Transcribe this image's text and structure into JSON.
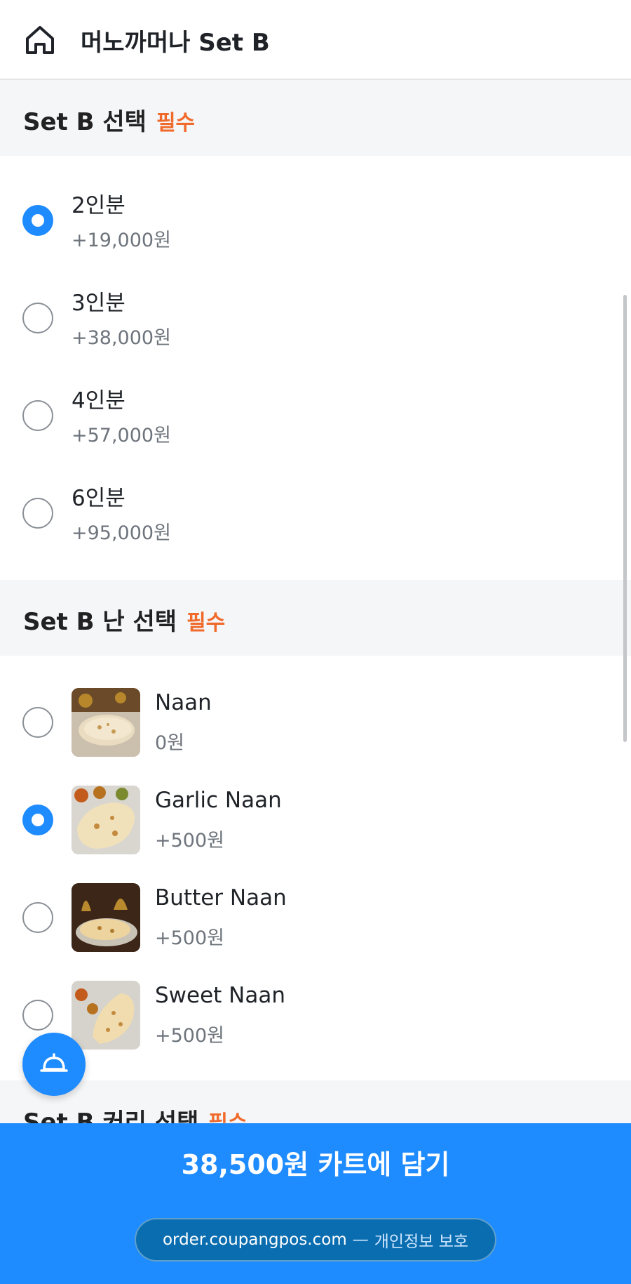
{
  "header": {
    "title": "머노까머나 Set B",
    "home_icon": "home-icon"
  },
  "sections": [
    {
      "label": "Set B 선택",
      "required": "필수",
      "options": [
        {
          "name": "2인분",
          "price": "+19,000원",
          "selected": true
        },
        {
          "name": "3인분",
          "price": "+38,000원",
          "selected": false
        },
        {
          "name": "4인분",
          "price": "+57,000원",
          "selected": false
        },
        {
          "name": "6인분",
          "price": "+95,000원",
          "selected": false
        }
      ]
    },
    {
      "label": "Set B 난 선택",
      "required": "필수",
      "options": [
        {
          "name": "Naan",
          "price": "0원",
          "selected": false
        },
        {
          "name": "Garlic Naan",
          "price": "+500원",
          "selected": true
        },
        {
          "name": "Butter Naan",
          "price": "+500원",
          "selected": false
        },
        {
          "name": "Sweet Naan",
          "price": "+500원",
          "selected": false
        }
      ]
    },
    {
      "label": "Set B 커리 선택",
      "required": "필수"
    }
  ],
  "fab": {
    "icon": "cloche-icon"
  },
  "cart": {
    "label": "38,500원 카트에 담기"
  },
  "footer": {
    "host": "order.coupangpos.com",
    "sep": "—",
    "note": "개인정보 보호"
  },
  "colors": {
    "accent": "#1e8bff",
    "required": "#f06a2b"
  }
}
